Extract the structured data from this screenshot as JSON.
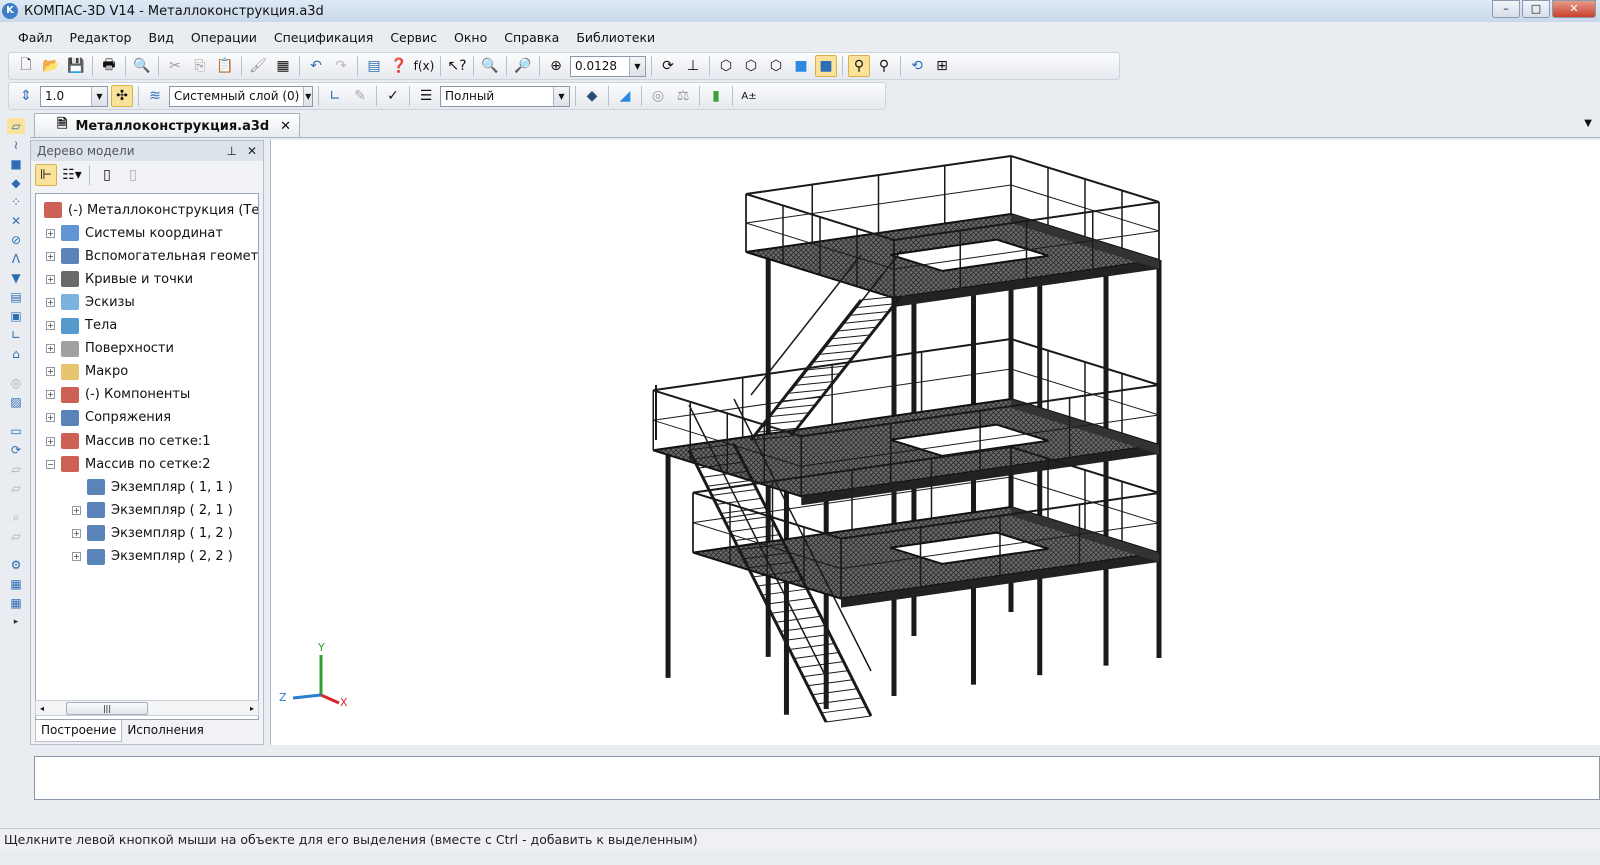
{
  "window": {
    "title": "КОМПАС-3D V14 - Металлоконструкция.a3d",
    "logo": "K"
  },
  "menu": [
    "Файл",
    "Редактор",
    "Вид",
    "Операции",
    "Спецификация",
    "Сервис",
    "Окно",
    "Справка",
    "Библиотеки"
  ],
  "toolbar": {
    "zoom_value": "0.0128",
    "step_value": "1.0",
    "layer_value": "Системный слой (0)",
    "style_value": "Полный"
  },
  "document_tab": {
    "label": "Металлоконструкция.a3d"
  },
  "panel": {
    "title": "Дерево модели",
    "tabs": [
      "Построение",
      "Исполнения"
    ]
  },
  "tree": [
    {
      "label": "(-) Металлоконструкция (Тел",
      "level": 0,
      "expander": "",
      "color": "#c0392b"
    },
    {
      "label": "Системы координат",
      "level": 1,
      "expander": "+",
      "color": "#3b7bc8"
    },
    {
      "label": "Вспомогательная геомет",
      "level": 1,
      "expander": "+",
      "color": "#2f64a8"
    },
    {
      "label": "Кривые и точки",
      "level": 1,
      "expander": "+",
      "color": "#444"
    },
    {
      "label": "Эскизы",
      "level": 1,
      "expander": "+",
      "color": "#5aa0d8"
    },
    {
      "label": "Тела",
      "level": 1,
      "expander": "+",
      "color": "#2b7fc0"
    },
    {
      "label": "Поверхности",
      "level": 1,
      "expander": "+",
      "color": "#888"
    },
    {
      "label": "Макро",
      "level": 1,
      "expander": "+",
      "color": "#e2b54a"
    },
    {
      "label": "(-) Компоненты",
      "level": 1,
      "expander": "+",
      "color": "#c0392b"
    },
    {
      "label": "Сопряжения",
      "level": 1,
      "expander": "+",
      "color": "#2f64a8"
    },
    {
      "label": "Массив по сетке:1",
      "level": 1,
      "expander": "+",
      "color": "#c0392b"
    },
    {
      "label": "Массив по сетке:2",
      "level": 1,
      "expander": "-",
      "color": "#c0392b"
    },
    {
      "label": "Экземпляр ( 1, 1 )",
      "level": 2,
      "expander": "",
      "color": "#2f64a8"
    },
    {
      "label": "Экземпляр ( 2, 1 )",
      "level": 2,
      "expander": "+",
      "color": "#2f64a8"
    },
    {
      "label": "Экземпляр ( 1, 2 )",
      "level": 2,
      "expander": "+",
      "color": "#2f64a8"
    },
    {
      "label": "Экземпляр ( 2, 2 )",
      "level": 2,
      "expander": "+",
      "color": "#2f64a8"
    }
  ],
  "axes": {
    "x": "X",
    "y": "Y",
    "z": "Z"
  },
  "status": "Щелкните левой кнопкой мыши на объекте для его выделения (вместе с Ctrl - добавить к выделенным)"
}
